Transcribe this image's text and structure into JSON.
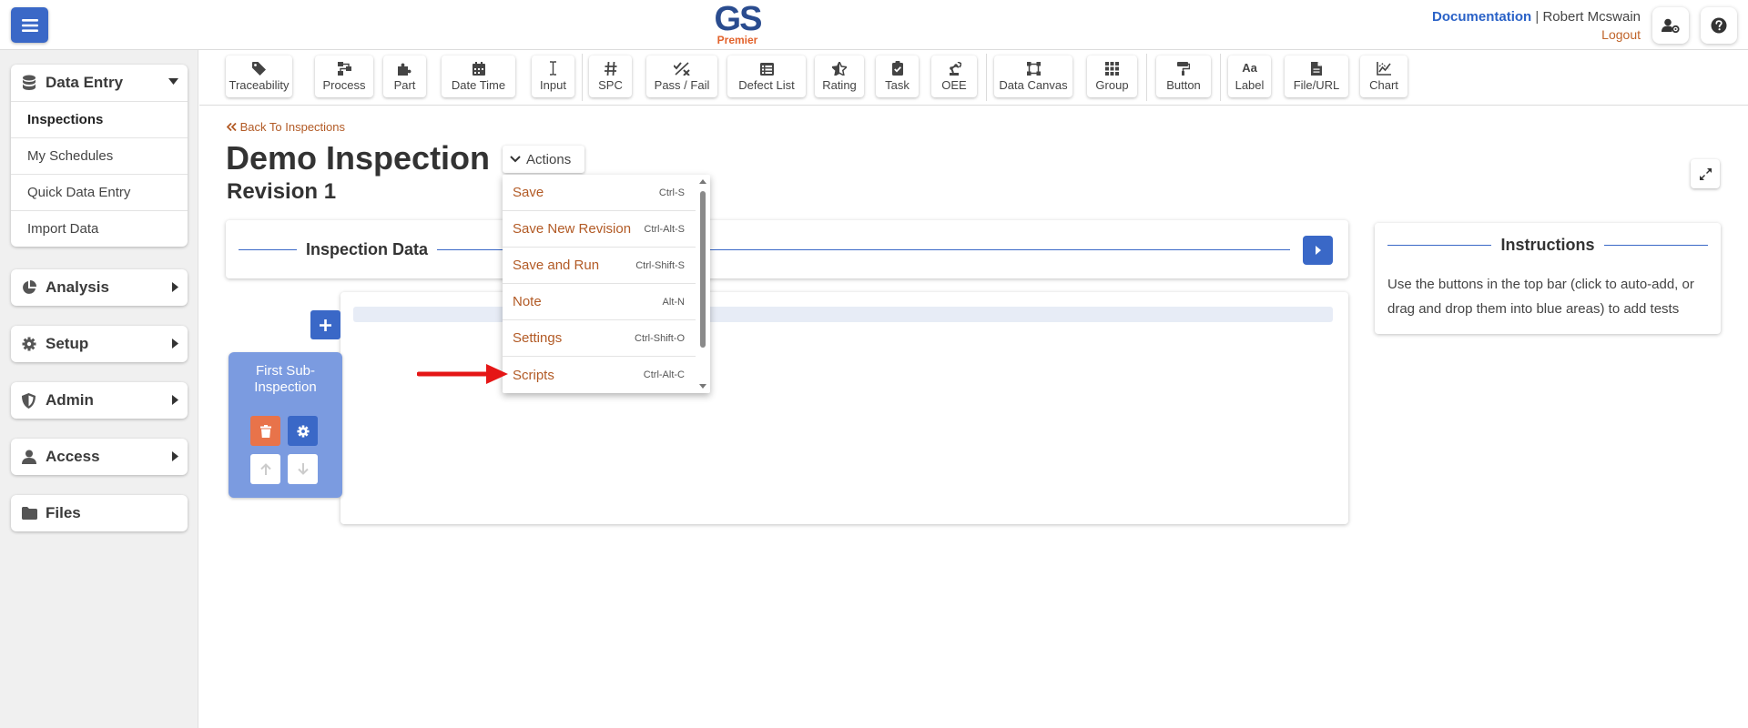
{
  "header": {
    "logo_main": "GS",
    "logo_sub": "Premier",
    "doc_link": "Documentation",
    "separator": "|",
    "user_name": "Robert Mcswain",
    "logout": "Logout"
  },
  "sidebar": {
    "data_entry": {
      "label": "Data Entry",
      "items": [
        "Inspections",
        "My Schedules",
        "Quick Data Entry",
        "Import Data"
      ]
    },
    "analysis": "Analysis",
    "setup": "Setup",
    "admin": "Admin",
    "access": "Access",
    "files": "Files"
  },
  "toolbar": {
    "items": [
      "Traceability",
      "Process",
      "Part",
      "Date Time",
      "Input",
      "SPC",
      "Pass / Fail",
      "Defect List",
      "Rating",
      "Task",
      "OEE",
      "Data Canvas",
      "Group",
      "Button",
      "Label",
      "File/URL",
      "Chart"
    ],
    "label_icon_text": "Aa"
  },
  "main": {
    "back_link": "Back To Inspections",
    "title": "Demo Inspection",
    "revision": "Revision 1",
    "actions_label": "Actions",
    "inspection_data_title": "Inspection Data",
    "sub_inspection_title": "First Sub-Inspection"
  },
  "instructions": {
    "title": "Instructions",
    "text": "Use the buttons in the top bar (click to auto-add, or drag and drop them into blue areas) to add tests"
  },
  "actions_menu": {
    "items": [
      {
        "label": "Save",
        "shortcut": "Ctrl-S"
      },
      {
        "label": "Save New Revision",
        "shortcut": "Ctrl-Alt-S"
      },
      {
        "label": "Save and Run",
        "shortcut": "Ctrl-Shift-S"
      },
      {
        "label": "Note",
        "shortcut": "Alt-N"
      },
      {
        "label": "Settings",
        "shortcut": "Ctrl-Shift-O"
      },
      {
        "label": "Scripts",
        "shortcut": "Ctrl-Alt-C"
      }
    ]
  },
  "colors": {
    "primary": "#3a68c7",
    "accent_orange": "#e2622b",
    "link_brown": "#b25a25",
    "sub_card": "#7b9be0",
    "red_arrow": "#e51616"
  }
}
